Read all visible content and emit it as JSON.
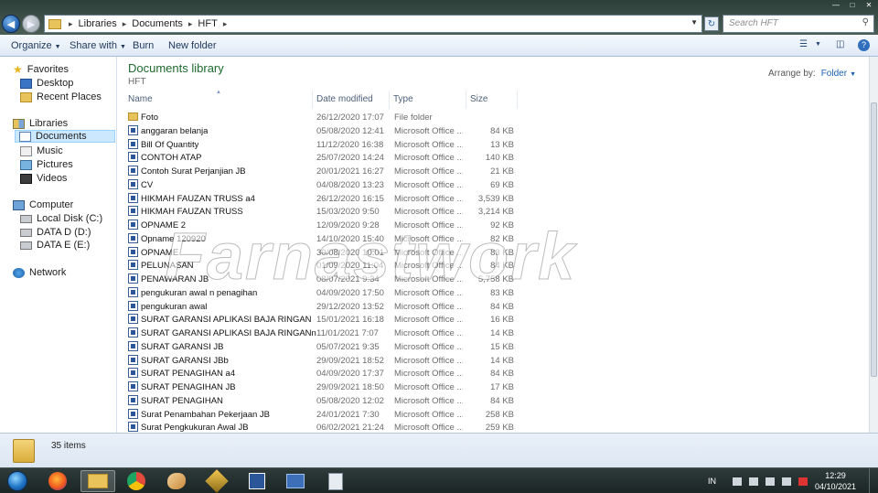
{
  "window": {
    "breadcrumb": [
      "Libraries",
      "Documents",
      "HFT"
    ],
    "search_placeholder": "Search HFT"
  },
  "toolbar": {
    "organize": "Organize",
    "share_with": "Share with",
    "burn": "Burn",
    "new_folder": "New folder"
  },
  "nav": {
    "favorites": "Favorites",
    "desktop": "Desktop",
    "recent_places": "Recent Places",
    "libraries": "Libraries",
    "documents": "Documents",
    "music": "Music",
    "pictures": "Pictures",
    "videos": "Videos",
    "computer": "Computer",
    "local_disk": "Local Disk (C:)",
    "data_d": "DATA D (D:)",
    "data_e": "DATA E (E:)",
    "network": "Network"
  },
  "library": {
    "title": "Documents library",
    "subtitle": "HFT",
    "arrange_label": "Arrange by:",
    "arrange_value": "Folder"
  },
  "columns": {
    "name": "Name",
    "date": "Date modified",
    "type": "Type",
    "size": "Size"
  },
  "files": [
    {
      "name": "Foto",
      "date": "26/12/2020 17:07",
      "type": "File folder",
      "size": "",
      "kind": "folder"
    },
    {
      "name": "anggaran belanja",
      "date": "05/08/2020 12:41",
      "type": "Microsoft Office ...",
      "size": "84 KB",
      "kind": "word"
    },
    {
      "name": "Bill Of Quantity",
      "date": "11/12/2020 16:38",
      "type": "Microsoft Office ...",
      "size": "13 KB",
      "kind": "word"
    },
    {
      "name": "CONTOH ATAP",
      "date": "25/07/2020 14:24",
      "type": "Microsoft Office ...",
      "size": "140 KB",
      "kind": "word"
    },
    {
      "name": "Contoh Surat Perjanjian JB",
      "date": "20/01/2021 16:27",
      "type": "Microsoft Office ...",
      "size": "21 KB",
      "kind": "word"
    },
    {
      "name": "CV",
      "date": "04/08/2020 13:23",
      "type": "Microsoft Office ...",
      "size": "69 KB",
      "kind": "word"
    },
    {
      "name": "HIKMAH FAUZAN TRUSS a4",
      "date": "26/12/2020 16:15",
      "type": "Microsoft Office ...",
      "size": "3,539 KB",
      "kind": "word"
    },
    {
      "name": "HIKMAH FAUZAN TRUSS",
      "date": "15/03/2020 9:50",
      "type": "Microsoft Office ...",
      "size": "3,214 KB",
      "kind": "word"
    },
    {
      "name": "OPNAME 2",
      "date": "12/09/2020 9:28",
      "type": "Microsoft Office ...",
      "size": "92 KB",
      "kind": "word"
    },
    {
      "name": "Opname 120920",
      "date": "14/10/2020 15:40",
      "type": "Microsoft Office ...",
      "size": "82 KB",
      "kind": "word"
    },
    {
      "name": "OPNAME",
      "date": "30/08/2020 10:01",
      "type": "Microsoft Office ...",
      "size": "83 KB",
      "kind": "word"
    },
    {
      "name": "PELUNASAN",
      "date": "01/09/2020 11:04",
      "type": "Microsoft Office ...",
      "size": "84 KB",
      "kind": "word"
    },
    {
      "name": "PENAWARAN JB",
      "date": "08/07/2021 9:34",
      "type": "Microsoft Office ...",
      "size": "5,758 KB",
      "kind": "word"
    },
    {
      "name": "pengukuran awal n penagihan",
      "date": "04/09/2020 17:50",
      "type": "Microsoft Office ...",
      "size": "83 KB",
      "kind": "word"
    },
    {
      "name": "pengukuran awal",
      "date": "29/12/2020 13:52",
      "type": "Microsoft Office ...",
      "size": "84 KB",
      "kind": "word"
    },
    {
      "name": "SURAT GARANSI APLIKASI BAJA RINGAN",
      "date": "15/01/2021 16:18",
      "type": "Microsoft Office ...",
      "size": "16 KB",
      "kind": "word"
    },
    {
      "name": "SURAT GARANSI APLIKASI BAJA RINGANn",
      "date": "11/01/2021 7:07",
      "type": "Microsoft Office ...",
      "size": "14 KB",
      "kind": "word"
    },
    {
      "name": "SURAT GARANSI JB",
      "date": "05/07/2021 9:35",
      "type": "Microsoft Office ...",
      "size": "15 KB",
      "kind": "word"
    },
    {
      "name": "SURAT GARANSI JBb",
      "date": "29/09/2021 18:52",
      "type": "Microsoft Office ...",
      "size": "14 KB",
      "kind": "word"
    },
    {
      "name": "SURAT PENAGIHAN a4",
      "date": "04/09/2020 17:37",
      "type": "Microsoft Office ...",
      "size": "84 KB",
      "kind": "word"
    },
    {
      "name": "SURAT PENAGIHAN JB",
      "date": "29/09/2021 18:50",
      "type": "Microsoft Office ...",
      "size": "17 KB",
      "kind": "word"
    },
    {
      "name": "SURAT PENAGIHAN",
      "date": "05/08/2020 12:02",
      "type": "Microsoft Office ...",
      "size": "84 KB",
      "kind": "word"
    },
    {
      "name": "Surat Penambahan Pekerjaan JB",
      "date": "24/01/2021 7:30",
      "type": "Microsoft Office ...",
      "size": "258 KB",
      "kind": "word"
    },
    {
      "name": "Surat Pengkukuran Awal JB",
      "date": "06/02/2021 21:24",
      "type": "Microsoft Office ...",
      "size": "259 KB",
      "kind": "word"
    }
  ],
  "status": {
    "count": "35 items"
  },
  "watermark": "Farnastwork",
  "taskbar": {
    "lang": "IN",
    "time": "12:29",
    "date": "04/10/2021"
  }
}
